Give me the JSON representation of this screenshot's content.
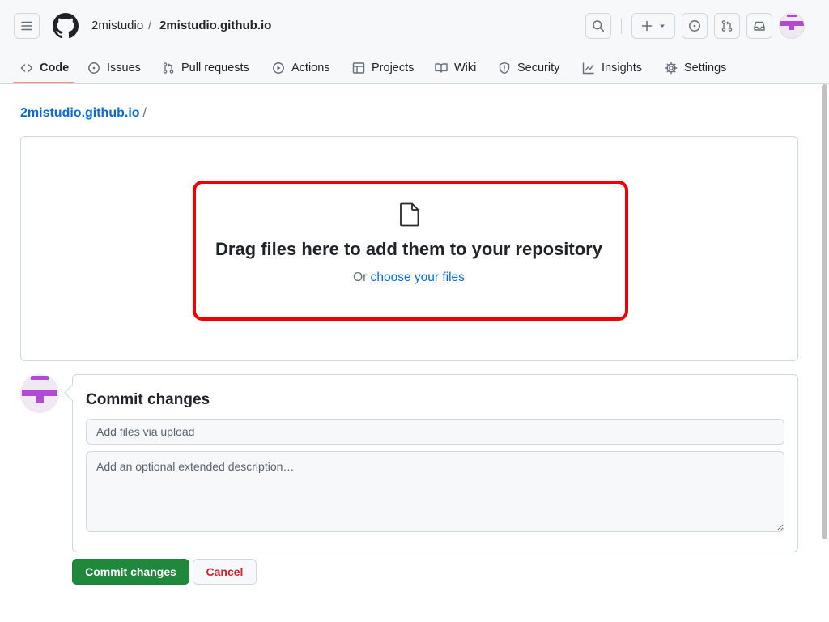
{
  "header": {
    "owner": "2mistudio",
    "separator": "/",
    "repo": "2mistudio.github.io",
    "icons": [
      "hamburger-menu-icon",
      "github-logo",
      "search-icon",
      "plus-icon",
      "triangle-down-icon",
      "issue-opened-icon",
      "git-pull-request-icon",
      "inbox-icon",
      "avatar"
    ]
  },
  "tabs": [
    {
      "label": "Code",
      "icon": "code-icon",
      "active": true
    },
    {
      "label": "Issues",
      "icon": "issue-icon"
    },
    {
      "label": "Pull requests",
      "icon": "pull-request-icon"
    },
    {
      "label": "Actions",
      "icon": "play-icon"
    },
    {
      "label": "Projects",
      "icon": "table-icon"
    },
    {
      "label": "Wiki",
      "icon": "book-icon"
    },
    {
      "label": "Security",
      "icon": "shield-icon"
    },
    {
      "label": "Insights",
      "icon": "graph-icon"
    },
    {
      "label": "Settings",
      "icon": "gear-icon"
    }
  ],
  "breadcrumb": {
    "repo": "2mistudio.github.io",
    "separator": "/"
  },
  "dropzone": {
    "title": "Drag files here to add them to your repository",
    "prefix": "Or",
    "link": "choose your files",
    "icon": "file-icon"
  },
  "commit": {
    "title": "Commit changes",
    "summary_placeholder": "Add files via upload",
    "description_placeholder": "Add an optional extended description…",
    "commit_button": "Commit changes",
    "cancel_button": "Cancel"
  },
  "colors": {
    "accent_link": "#0969da",
    "primary_button": "#1f883d",
    "danger_text": "#cf222e",
    "highlight_border": "#f00000",
    "tab_underline": "#fd8c73",
    "avatar_magenta": "#b14bd3"
  }
}
